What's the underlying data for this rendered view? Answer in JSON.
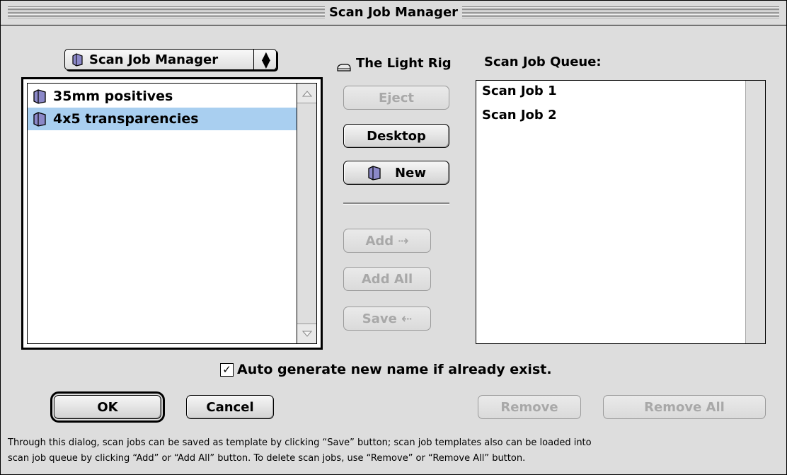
{
  "window": {
    "title": "Scan Job Manager"
  },
  "left_panel": {
    "popup_label": "Scan Job Manager",
    "popup_icon": "folder-icon",
    "items": [
      {
        "label": "35mm positives",
        "icon": "folder-icon",
        "selected": false
      },
      {
        "label": "4x5 transparencies",
        "icon": "folder-icon",
        "selected": true
      }
    ]
  },
  "middle": {
    "volume_label": "The Light Rig",
    "volume_icon": "disk-icon",
    "eject_label": "Eject",
    "desktop_label": "Desktop",
    "new_label": "New",
    "add_label": "Add ⇢",
    "add_all_label": "Add All",
    "save_label": "Save ⇠"
  },
  "queue": {
    "header": "Scan Job Queue:",
    "items": [
      "Scan Job 1",
      "Scan Job 2"
    ]
  },
  "options": {
    "auto_generate_label": "Auto generate new name if already exist.",
    "auto_generate_checked": true
  },
  "buttons": {
    "ok_label": "OK",
    "cancel_label": "Cancel",
    "remove_label": "Remove",
    "remove_all_label": "Remove All"
  },
  "footer": {
    "line1": "Through this dialog, scan jobs can be saved as template by clicking “Save” button; scan job templates also can be loaded into",
    "line2": "scan job queue by clicking “Add” or “Add All” button. To delete scan jobs, use “Remove” or “Remove All” button."
  },
  "colors": {
    "selection": "#a9cff0",
    "disabled_text": "#a8a8a8"
  }
}
